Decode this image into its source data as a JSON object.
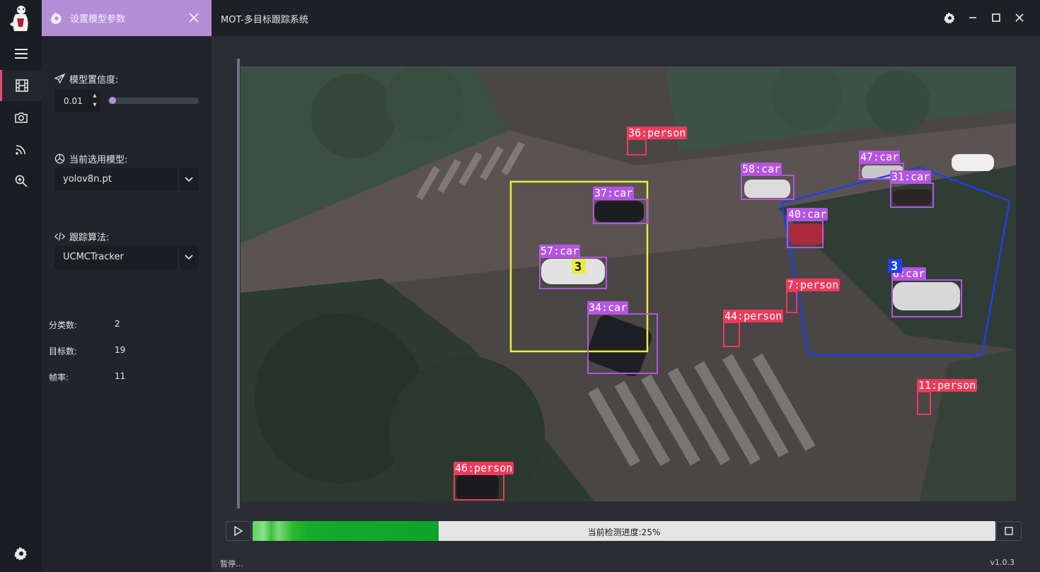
{
  "window": {
    "title": "MOT-多目标跟踪系统",
    "panel_tab_label": "设置模型参数"
  },
  "sidebar": {
    "items": [
      {
        "name": "menu",
        "icon": "hamburger-icon",
        "active": false
      },
      {
        "name": "video",
        "icon": "film-icon",
        "active": true
      },
      {
        "name": "camera",
        "icon": "camera-icon",
        "active": false
      },
      {
        "name": "stream",
        "icon": "rss-icon",
        "active": false
      },
      {
        "name": "detect",
        "icon": "zoom-icon",
        "active": false
      }
    ],
    "bottom_icon": "gear-icon"
  },
  "settings": {
    "confidence_label": "模型置信度:",
    "confidence_value": "0.01",
    "confidence_slider_fraction": 0.01,
    "model_label": "当前选用模型:",
    "model_value": "yolov8n.pt",
    "tracker_label": "跟踪算法:",
    "tracker_value": "UCMCTracker",
    "stats": [
      {
        "label": "分类数:",
        "value": "2"
      },
      {
        "label": "目标数:",
        "value": "19"
      },
      {
        "label": "帧率:",
        "value": "11"
      }
    ]
  },
  "detections": [
    {
      "label": "36:person",
      "cls": "person"
    },
    {
      "label": "47:car",
      "cls": "car"
    },
    {
      "label": "58:car",
      "cls": "car"
    },
    {
      "label": "31:car",
      "cls": "car"
    },
    {
      "label": "37:car",
      "cls": "car"
    },
    {
      "label": "40:car",
      "cls": "car"
    },
    {
      "label": "57:car",
      "cls": "car"
    },
    {
      "label": "7:person",
      "cls": "person"
    },
    {
      "label": "6:car",
      "cls": "car"
    },
    {
      "label": "44:person",
      "cls": "person"
    },
    {
      "label": "34:car",
      "cls": "car"
    },
    {
      "label": "11:person",
      "cls": "person"
    },
    {
      "label": "46:person",
      "cls": "person"
    }
  ],
  "regions": [
    {
      "count": "3",
      "shape": "rectangle",
      "color": "#e8ee3c"
    },
    {
      "count": "3",
      "shape": "pentagon",
      "color": "#1f3fe8"
    }
  ],
  "colors": {
    "accent": "#b48fd8",
    "person": "#ee3a5a",
    "car": "#b455e0",
    "progress": "#0aa52a"
  },
  "playback": {
    "progress_text": "当前检测进度:25%",
    "progress_fraction": 0.25,
    "status": "暂停...",
    "version": "v1.0.3"
  }
}
